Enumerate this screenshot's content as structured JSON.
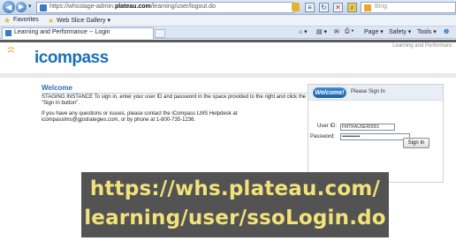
{
  "browser": {
    "url_prefix": "https://whsstage-admin.",
    "url_domain": "plateau.com",
    "url_path": "/learning/user/logout.do",
    "search_placeholder": "Bing",
    "favorites_label": "Favorites",
    "web_slice_label": "Web Slice Gallery ▾",
    "tab_title": "Learning and Performance -- Login",
    "toolbar": {
      "page": "Page ▾",
      "safety": "Safety ▾",
      "tools": "Tools ▾"
    }
  },
  "page": {
    "header_right": "Learning and Performanc",
    "logo_text": "icompass",
    "welcome_title": "Welcome",
    "welcome_text": "STAGING INSTANCE To sign in, enter your user ID and password in the space provided to the right and click the \"Sign In button\".",
    "help_text": "If you have any questions or issues, please contact the iCompass LMS Helpdesk at icompasslms@gpstrategies.com, or by phone at 1-800-735-1236.",
    "signin": {
      "badge": "Welcome!",
      "heading": "Please Sign In",
      "user_id_label": "User ID:",
      "user_id_value": "FMTRAUSER0001",
      "password_label": "Password:",
      "password_value": "••••••••••••••••",
      "button": "Sign In"
    }
  },
  "caption": {
    "line1": "https://whs.plateau.com/",
    "line2": "learning/user/ssoLogin.do"
  },
  "colors": {
    "accent": "#2a6fb6",
    "logo_orange": "#f0a21c",
    "caption_text": "#f2e27a",
    "caption_bg": "#464646"
  }
}
